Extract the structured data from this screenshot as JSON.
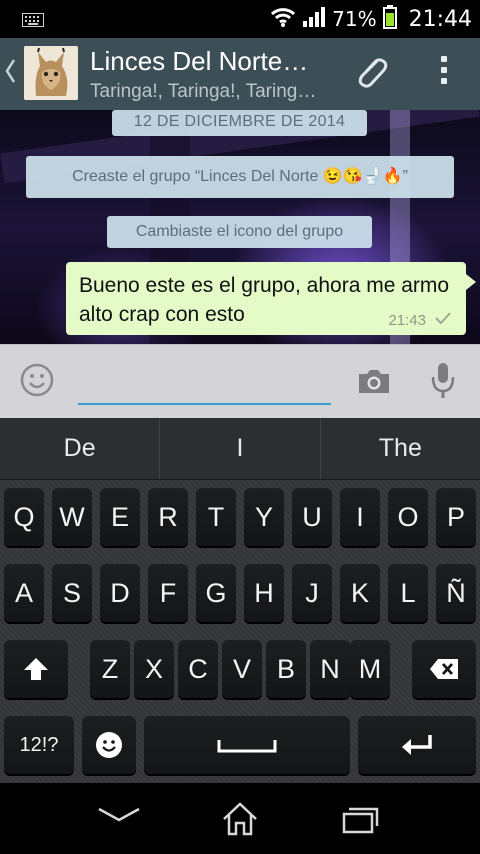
{
  "status_bar": {
    "battery_percent": "71%",
    "time": "21:44"
  },
  "header": {
    "title": "Linces Del Norte…",
    "subtitle": "Taringa!, Taringa!, Taring…"
  },
  "chat": {
    "date_label": "12 DE DICIEMBRE DE 2014",
    "system_messages": [
      "Creaste el grupo “Linces Del Norte 😉😘🚽🔥”",
      "Cambiaste el icono del grupo"
    ],
    "message": {
      "text": "Bueno este es el grupo, ahora me armo alto crap con esto",
      "time": "21:43"
    }
  },
  "compose": {
    "input_value": ""
  },
  "suggestions": [
    "De",
    "I",
    "The"
  ],
  "keyboard": {
    "row1": [
      "Q",
      "W",
      "E",
      "R",
      "T",
      "Y",
      "U",
      "I",
      "O",
      "P"
    ],
    "row2": [
      "A",
      "S",
      "D",
      "F",
      "G",
      "H",
      "J",
      "K",
      "L",
      "Ñ"
    ],
    "row3": [
      "Z",
      "X",
      "C",
      "V",
      "B",
      "N",
      "M"
    ],
    "symbols_label": "12!?"
  },
  "colors": {
    "action_bar": "#3d4f56",
    "bubble": "#e4fbc7",
    "system_pill": "#cde1ec",
    "input_underline": "#3b9fc9"
  },
  "icons": [
    "keyboard-icon",
    "wifi-icon",
    "signal-icon",
    "battery-icon",
    "back-chevron-icon",
    "group-avatar",
    "paperclip-icon",
    "overflow-menu-icon",
    "check-icon",
    "emoji-icon",
    "camera-icon",
    "mic-icon",
    "shift-icon",
    "backspace-icon",
    "emoji-key-icon",
    "enter-icon",
    "nav-back-icon",
    "nav-home-icon",
    "nav-recents-icon"
  ]
}
